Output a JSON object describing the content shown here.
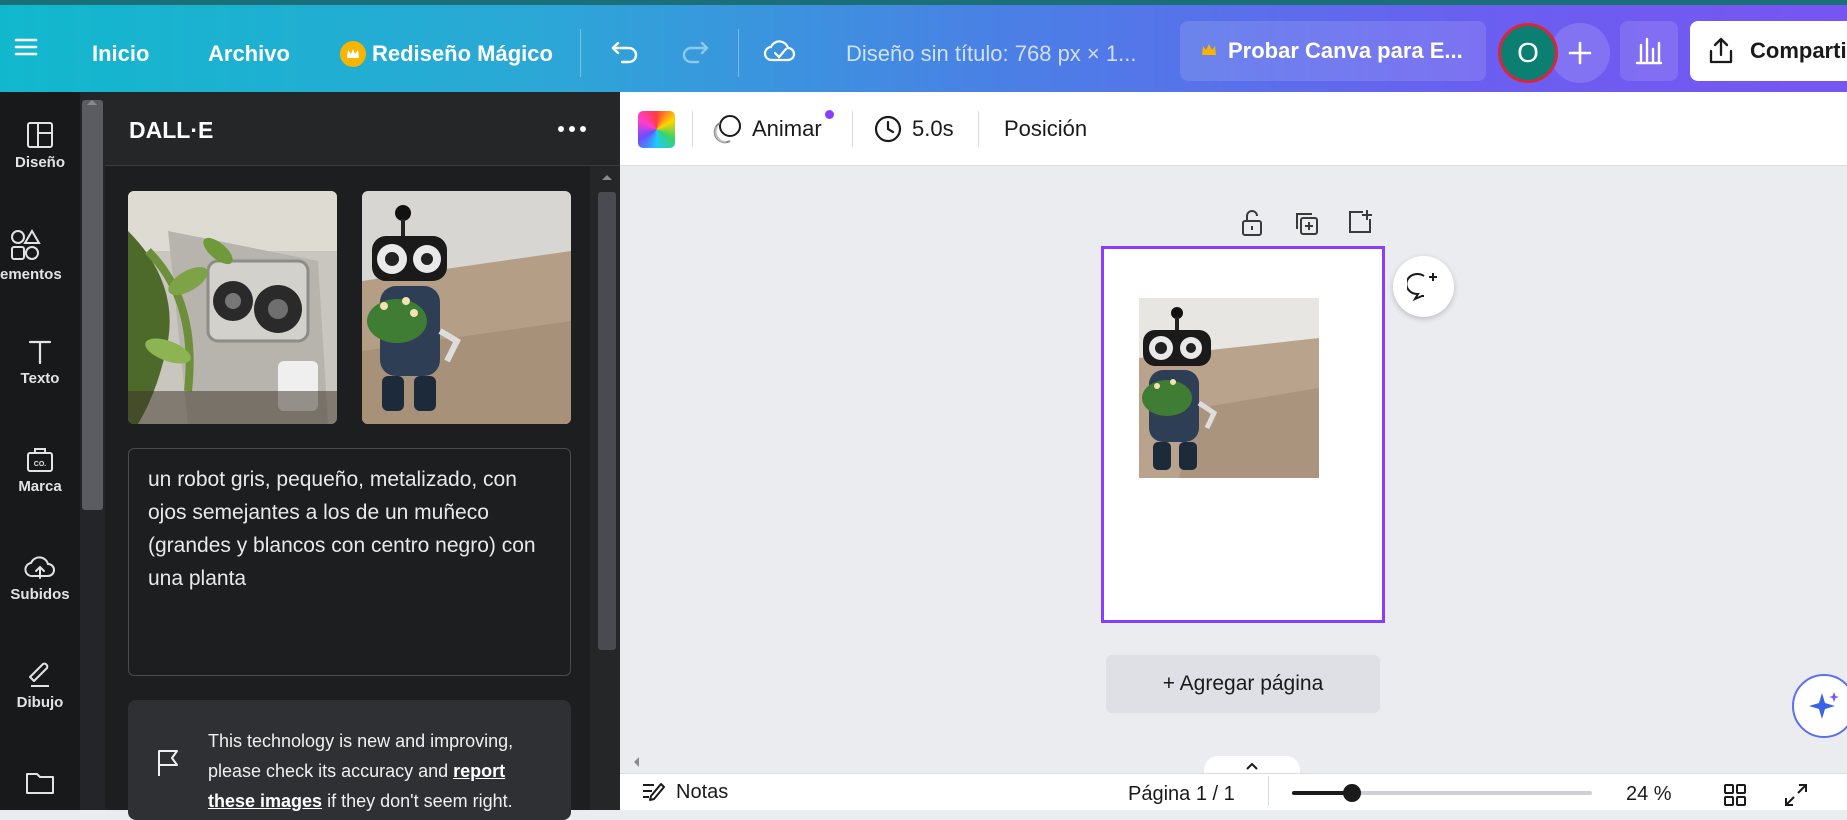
{
  "topbar": {
    "menu_icon": "hamburger-icon",
    "nav": [
      "Inicio",
      "Archivo"
    ],
    "magic_resize": "Rediseño Mágico",
    "doc_title": "Diseño sin título: 768 px × 1...",
    "try_pro": "Probar Canva para E...",
    "avatar_initial": "O",
    "share": "Comparti",
    "avatar_color": "#0c7f73",
    "avatar_ring": "#d8263a"
  },
  "leftrail": {
    "items": [
      {
        "label": "Diseño",
        "icon": "layout-icon"
      },
      {
        "label": "ementos",
        "icon": "shapes-icon"
      },
      {
        "label": "Texto",
        "icon": "text-icon"
      },
      {
        "label": "Marca",
        "icon": "brand-icon"
      },
      {
        "label": "Subidos",
        "icon": "cloud-upload-icon"
      },
      {
        "label": "Dibujo",
        "icon": "draw-icon"
      },
      {
        "label": "",
        "icon": "folder-icon"
      }
    ]
  },
  "panel": {
    "title": "DALL·E",
    "prompt": "un robot gris, pequeño, metalizado, con ojos semejantes a los de un muñeco (grandes y blancos con centro negro) con una planta",
    "notice_text_1": "This technology is new and improving, please check its accuracy and",
    "notice_link": "report these images",
    "notice_text_2": "if they don't seem right."
  },
  "context_toolbar": {
    "animate": "Animar",
    "duration": "5.0s",
    "position": "Posición"
  },
  "canvas": {
    "add_page": "+ Agregar página"
  },
  "footer": {
    "notes": "Notas",
    "page_indicator": "Página 1 / 1",
    "zoom": "24 %",
    "zoom_fraction": 0.2
  },
  "colors": {
    "accent": "#8b3dff",
    "panel_bg": "#252627",
    "rail_bg": "#18191b"
  }
}
